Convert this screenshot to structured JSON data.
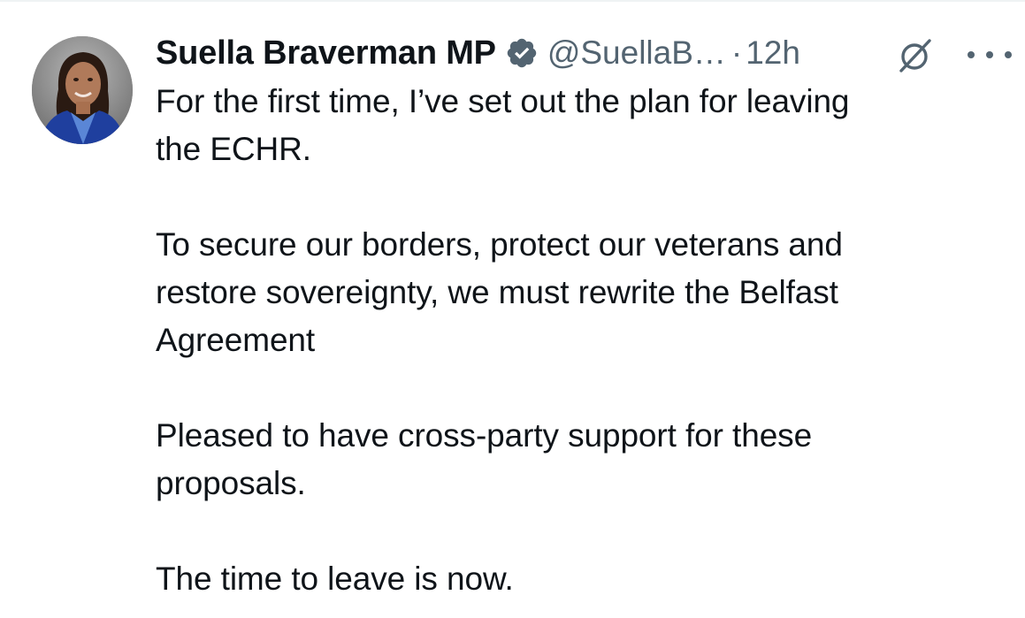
{
  "tweet": {
    "author": {
      "name": "Suella Braverman MP",
      "handle": "@SuellaB…",
      "separator": "·",
      "time": "12h"
    },
    "icons": {
      "verified": "verified-badge-icon",
      "grok": "grok-icon",
      "more": "more-options-icon"
    },
    "colors": {
      "text": "#0f1419",
      "secondary": "#536471",
      "badge": "#536471"
    },
    "paragraphs": [
      [
        "For the first time, I’ve set out the plan for leaving",
        "the ECHR."
      ],
      [
        "To secure our borders, protect our veterans and",
        "restore sovereignty, we must rewrite the Belfast",
        "Agreement"
      ],
      [
        "Pleased to have cross-party support for these",
        "proposals."
      ],
      [
        "The time to leave is now."
      ]
    ]
  }
}
